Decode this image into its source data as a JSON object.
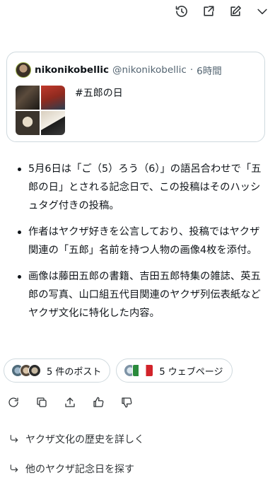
{
  "toolbar": {
    "icons": [
      "history-icon",
      "share-out-icon",
      "edit-icon",
      "chevron-down-icon"
    ]
  },
  "post_card": {
    "username": "nikonikobellic",
    "handle": "@nikonikobellic",
    "separator": "·",
    "time": "6時間",
    "text": "#五郎の日"
  },
  "summary": {
    "bullets": [
      "5月6日は「ご（5）ろう（6）」の語呂合わせで「五郎の日」とされる記念日で、この投稿はそのハッシュタグ付きの投稿。",
      "作者はヤクザ好きを公言しており、投稿ではヤクザ関連の「五郎」名前を持つ人物の画像4枚を添付。",
      "画像は藤田五郎の書籍、吉田五郎特集の雑誌、英五郎の写真、山口組五代目関連のヤクザ列伝表紙などヤクザ文化に特化した内容。"
    ]
  },
  "sources": {
    "posts_label": "5 件のポスト",
    "web_label": "5 ウェブページ"
  },
  "actions": [
    "regenerate-icon",
    "copy-icon",
    "share-icon",
    "thumbs-up-icon",
    "thumbs-down-icon"
  ],
  "followups": [
    "ヤクザ文化の歴史を詳しく",
    "他のヤクザ記念日を探す"
  ]
}
